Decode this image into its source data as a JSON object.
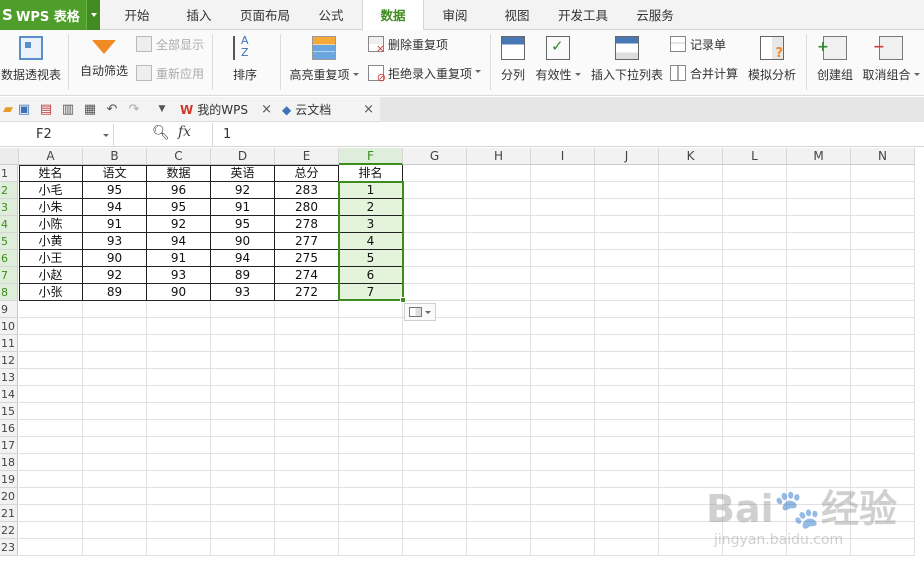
{
  "app": {
    "logo": "S",
    "title": "WPS 表格"
  },
  "tabs": [
    "开始",
    "插入",
    "页面布局",
    "公式",
    "数据",
    "审阅",
    "视图",
    "开发工具",
    "云服务"
  ],
  "active_tab": "数据",
  "ribbon": {
    "pivot": "数据透视表",
    "auto_filter": "自动筛选",
    "show_all": "全部显示",
    "reapply": "重新应用",
    "sort": "排序",
    "highlight_dup": "高亮重复项",
    "delete_dup": "删除重复项",
    "reject_dup": "拒绝录入重复项",
    "split_col": "分列",
    "validity": "有效性",
    "insert_dropdown": "插入下拉列表",
    "record_form": "记录单",
    "merge_calc": "合并计算",
    "simulate": "模拟分析",
    "create_group": "创建组",
    "ungroup": "取消组合"
  },
  "doc_tabs": [
    {
      "label": "我的WPS",
      "icon": "W"
    },
    {
      "label": "云文档",
      "icon": "◆"
    }
  ],
  "formula_bar": {
    "name_box": "F2",
    "fx": "fx",
    "value": "1"
  },
  "columns": [
    "A",
    "B",
    "C",
    "D",
    "E",
    "F",
    "G",
    "H",
    "I",
    "J",
    "K",
    "L",
    "M",
    "N"
  ],
  "rows": [
    "1",
    "2",
    "3",
    "4",
    "5",
    "6",
    "7",
    "8",
    "9",
    "10",
    "11",
    "12",
    "13",
    "14",
    "15",
    "16",
    "17",
    "18",
    "19",
    "20",
    "21",
    "22",
    "23"
  ],
  "table": {
    "header": [
      "姓名",
      "语文",
      "数据",
      "英语",
      "总分",
      "排名"
    ],
    "rows": [
      [
        "小毛",
        "95",
        "96",
        "92",
        "283",
        "1"
      ],
      [
        "小朱",
        "94",
        "95",
        "91",
        "280",
        "2"
      ],
      [
        "小陈",
        "91",
        "92",
        "95",
        "278",
        "3"
      ],
      [
        "小黄",
        "93",
        "94",
        "90",
        "277",
        "4"
      ],
      [
        "小王",
        "90",
        "91",
        "94",
        "275",
        "5"
      ],
      [
        "小赵",
        "92",
        "93",
        "89",
        "274",
        "6"
      ],
      [
        "小张",
        "89",
        "90",
        "93",
        "272",
        "7"
      ]
    ]
  },
  "selected_column": "F",
  "selected_rows": [
    "2",
    "3",
    "4",
    "5",
    "6",
    "7",
    "8"
  ],
  "watermark": {
    "line1": "Bai🐾经验",
    "line2": "jingyan.baidu.com"
  },
  "colors": {
    "accent": "#3e8b1e",
    "app_green": "#4f9e2b",
    "selection_fill": "#e3f3dc"
  }
}
